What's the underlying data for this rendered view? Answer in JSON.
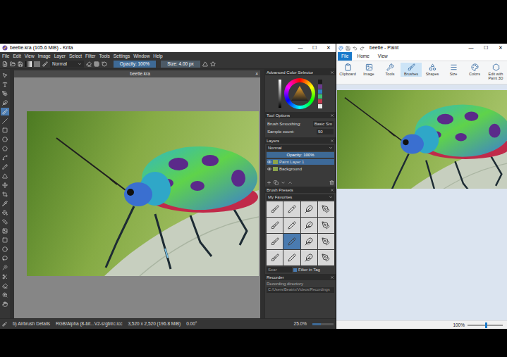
{
  "krita": {
    "title": "beetle.kra (105.6 MiB) - Krita",
    "window_controls": [
      "—",
      "☐",
      "✕"
    ],
    "menu": [
      "File",
      "Edit",
      "View",
      "Image",
      "Layer",
      "Select",
      "Filter",
      "Tools",
      "Settings",
      "Window",
      "Help"
    ],
    "toolbar": {
      "blend_mode": "Normal",
      "opacity": "Opacity: 100%",
      "size": "Size: 4.00 px"
    },
    "document_tab": {
      "title": "beetle.kra",
      "close": "×"
    },
    "toolbox": [
      {
        "kind": "select",
        "selected": false
      },
      {
        "kind": "text",
        "selected": false
      },
      {
        "kind": "edit-shape",
        "selected": false
      },
      {
        "kind": "calligraphy",
        "selected": false
      },
      {
        "kind": "brush",
        "selected": true
      },
      {
        "kind": "line",
        "selected": false
      },
      {
        "kind": "rectangle",
        "selected": false
      },
      {
        "kind": "ellipse",
        "selected": false
      },
      {
        "kind": "polygon",
        "selected": false
      },
      {
        "kind": "bezier",
        "selected": false
      },
      {
        "kind": "freehand",
        "selected": false
      },
      {
        "kind": "transform",
        "selected": false
      },
      {
        "kind": "move",
        "selected": false
      },
      {
        "kind": "crop",
        "selected": false
      },
      {
        "kind": "picker",
        "selected": false
      },
      {
        "kind": "fill",
        "selected": false
      },
      {
        "kind": "measure",
        "selected": false
      },
      {
        "kind": "reference",
        "selected": false
      },
      {
        "kind": "rect-select",
        "selected": false
      },
      {
        "kind": "ellipse-select",
        "selected": false
      },
      {
        "kind": "lasso",
        "selected": false
      },
      {
        "kind": "wand",
        "selected": false
      },
      {
        "kind": "cut",
        "selected": false
      },
      {
        "kind": "eraser",
        "selected": false
      },
      {
        "kind": "zoom",
        "selected": false
      },
      {
        "kind": "pan",
        "selected": false
      }
    ],
    "color_selector": {
      "title": "Advanced Color Selector",
      "swatches": [
        {
          "color": "#1b1b1b"
        },
        {
          "color": "#6b3a8f"
        },
        {
          "color": "#2f7fc4"
        },
        {
          "color": "#3fbf6f"
        },
        {
          "color": "#c23a4e"
        },
        {
          "color": "#e8e8e8"
        }
      ]
    },
    "tool_options": {
      "title": "Tool Options",
      "rows": [
        {
          "label": "Brush Smoothing:",
          "value": "Basic Sm"
        },
        {
          "label": "Sample count:",
          "value": "50"
        }
      ]
    },
    "layers": {
      "title": "Layers",
      "blend_mode": "Normal",
      "opacity": "Opacity: 100%",
      "items": [
        {
          "name": "Paint Layer 1",
          "selected": true,
          "visible": true
        },
        {
          "name": "Background",
          "selected": false,
          "visible": true
        }
      ]
    },
    "brush_presets": {
      "title": "Brush Presets",
      "tag": "My Favorites",
      "presets": [
        {
          "selected": false
        },
        {
          "selected": false
        },
        {
          "selected": false
        },
        {
          "selected": false
        },
        {
          "selected": false
        },
        {
          "selected": false
        },
        {
          "selected": false
        },
        {
          "selected": false
        },
        {
          "selected": false
        },
        {
          "selected": true
        },
        {
          "selected": false
        },
        {
          "selected": false
        },
        {
          "selected": false
        },
        {
          "selected": false
        },
        {
          "selected": false
        },
        {
          "selected": false
        }
      ],
      "search_placeholder": "Sear",
      "filter": "Filter in Tag",
      "filter_checked": true
    },
    "recorder": {
      "title": "Recorder",
      "label": "Recording directory",
      "path": "C:/Users/Beatrix/Videos/Recordings"
    },
    "status": {
      "brush": "b) Airbrush Details",
      "color_space": "RGB/Alpha (8-bit...V2-srgbtrc.icc",
      "size": "3,520 x 2,520 (196.8 MiB)",
      "rotation": "0.00°",
      "zoom": "25.0%",
      "zoom_level": 0.4
    }
  },
  "paint": {
    "title": "beetle - Paint",
    "window_controls": [
      "—",
      "☐",
      "✕"
    ],
    "tabs": [
      {
        "label": "File",
        "selected": true
      },
      {
        "label": "Home",
        "selected": false
      },
      {
        "label": "View",
        "selected": false
      }
    ],
    "ribbon": [
      {
        "label": "Clipboard",
        "kind": "clipboard",
        "selected": false
      },
      {
        "label": "Image",
        "kind": "image",
        "selected": false
      },
      {
        "label": "Tools",
        "kind": "tools",
        "selected": false
      },
      {
        "label": "Brushes",
        "kind": "brushes",
        "selected": true
      },
      {
        "label": "Shapes",
        "kind": "shapes",
        "selected": false
      },
      {
        "label": "Size",
        "kind": "size",
        "selected": false
      },
      {
        "label": "Colors",
        "kind": "colors",
        "selected": false
      },
      {
        "label": "Edit with Paint 3D",
        "kind": "paint3d",
        "selected": false
      }
    ],
    "status": {
      "zoom": "100%",
      "zoom_level": 0.5
    }
  }
}
